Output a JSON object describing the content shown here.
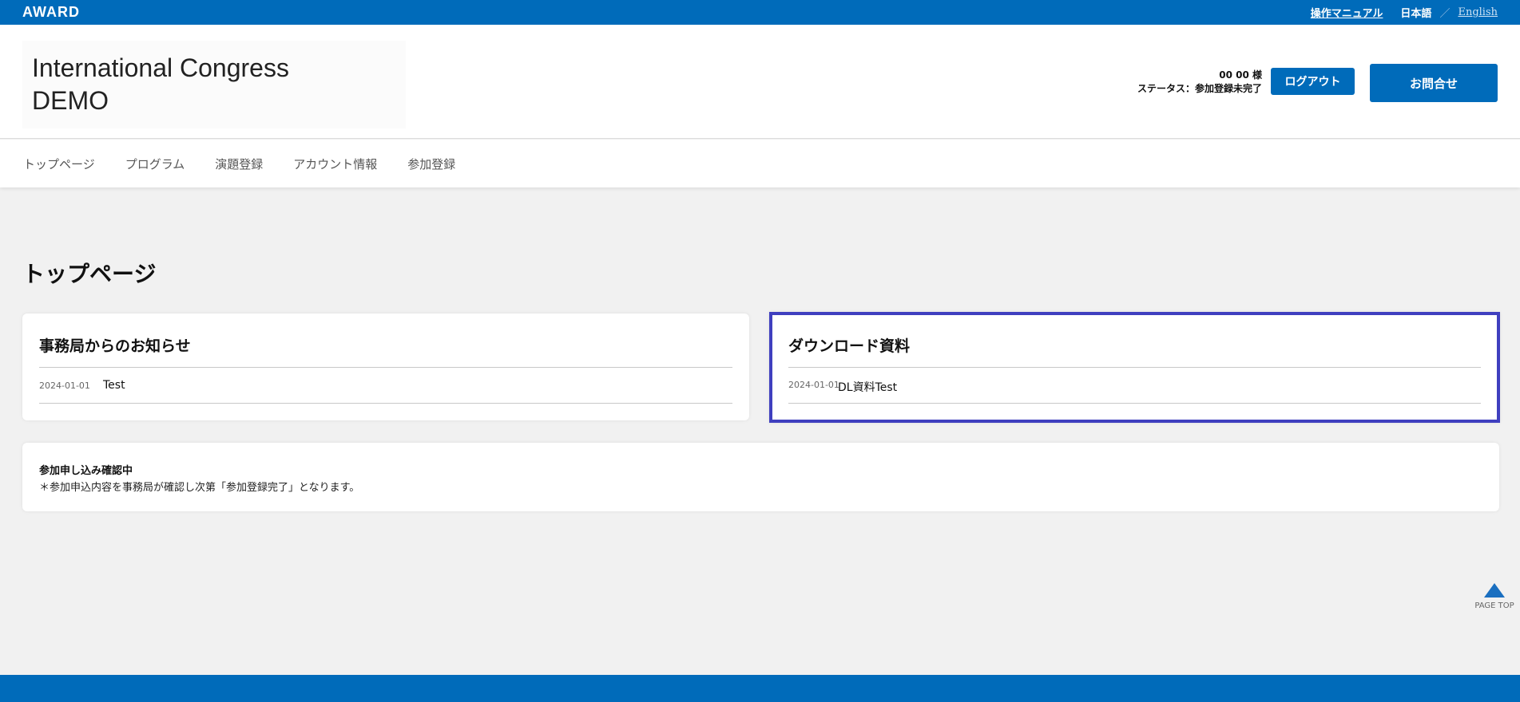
{
  "topbar": {
    "logo": "AWARD",
    "manual_link": "操作マニュアル",
    "lang_ja": "日本語",
    "lang_separator": "／",
    "lang_en": "English"
  },
  "header": {
    "site_title": "International Congress\nDEMO",
    "user_name": "00 00 様",
    "status_text": "ステータス：参加登録未完了",
    "logout_label": "ログアウト",
    "contact_label": "お問合せ"
  },
  "nav": {
    "items": [
      {
        "label": "トップページ"
      },
      {
        "label": "プログラム"
      },
      {
        "label": "演題登録"
      },
      {
        "label": "アカウント情報"
      },
      {
        "label": "参加登録"
      }
    ]
  },
  "main": {
    "page_title": "トップページ",
    "news": {
      "heading": "事務局からのお知らせ",
      "items": [
        {
          "date": "2024-01-01",
          "title": "Test"
        }
      ]
    },
    "downloads": {
      "heading": "ダウンロード資料",
      "items": [
        {
          "date": "2024-01-01",
          "title": "DL資料Test"
        }
      ]
    },
    "status_notice": {
      "title": "参加申し込み確認中",
      "note": "＊参加申込内容を事務局が確認し次第「参加登録完了」となります。"
    }
  },
  "page_top": {
    "label": "PAGE TOP",
    "icon": "up-triangle-icon"
  },
  "colors": {
    "brand_blue": "#006bba",
    "highlight_border": "#3f3fbf",
    "background": "#f1f1f1"
  }
}
